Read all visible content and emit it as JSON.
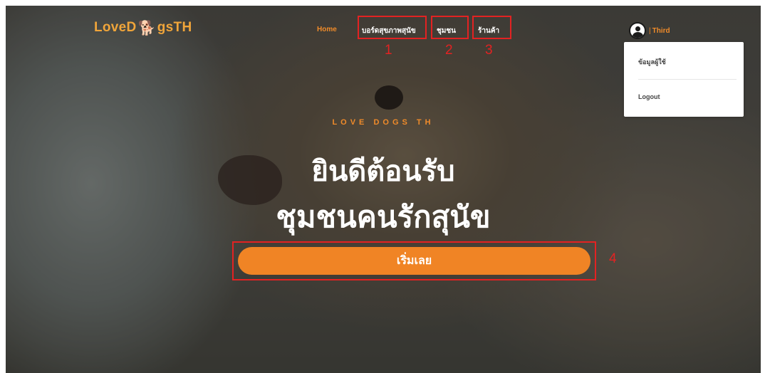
{
  "brand": {
    "logo_left": "LoveD",
    "logo_right": "gsTH"
  },
  "nav": {
    "home": "Home",
    "items": [
      "บอร์ดสุขภาพสุนัข",
      "ชุมชน",
      "ร้านค้า"
    ]
  },
  "annotations": [
    "1",
    "2",
    "3",
    "4"
  ],
  "user": {
    "separator": "|",
    "name": "Third",
    "menu": [
      "ข้อมูลผู้ใช้",
      "Logout"
    ]
  },
  "hero": {
    "tagline": "LOVE DOGS TH",
    "line1": "ยินดีต้อนรับ",
    "line2": "ชุมชนคนรักสุนัข",
    "cta": "เริ่มเลย"
  },
  "colors": {
    "accent": "#f08425",
    "annotation": "#e32222",
    "text_light": "#ffffff"
  }
}
